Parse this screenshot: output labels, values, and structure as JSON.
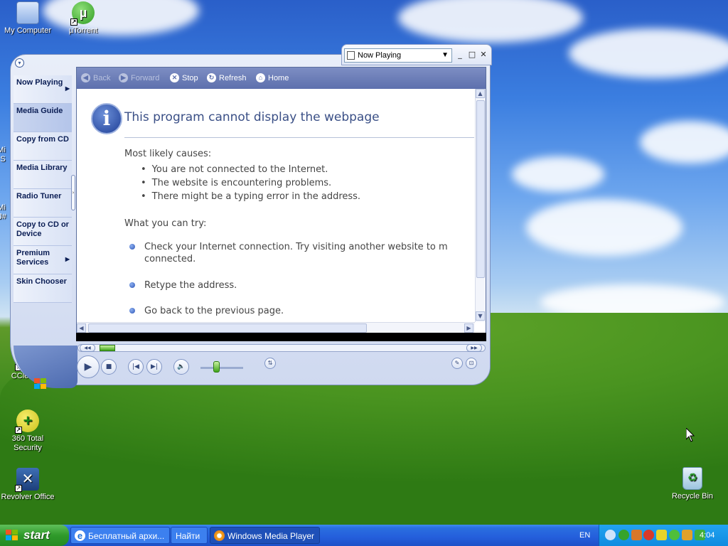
{
  "desktop": {
    "icons": [
      {
        "label": "My Computer",
        "icon": "computer-icon"
      },
      {
        "label": "µTorrent",
        "icon": "utorrent-icon"
      },
      {
        "label": "CCleaner",
        "icon": "ccleaner-icon"
      },
      {
        "label": "360 Total Security",
        "icon": "360-security-icon"
      },
      {
        "label": "Revolver Office",
        "icon": "revolver-office-icon"
      },
      {
        "label": "Recycle Bin",
        "icon": "recycle-bin-icon"
      }
    ],
    "partial_labels": [
      "Mi",
      "S",
      "Mi",
      "J#"
    ]
  },
  "wmp": {
    "now_playing_select": "Now Playing",
    "window_buttons": {
      "minimize": "_",
      "maximize": "□",
      "close": "✕"
    },
    "sidebar": [
      {
        "label": "Now Playing",
        "arrow": true,
        "active": false
      },
      {
        "label": "Media Guide",
        "arrow": false,
        "active": true
      },
      {
        "label": "Copy from CD",
        "arrow": false,
        "active": false
      },
      {
        "label": "Media Library",
        "arrow": false,
        "active": false
      },
      {
        "label": "Radio Tuner",
        "arrow": false,
        "active": false
      },
      {
        "label": "Copy to CD or Device",
        "arrow": false,
        "active": false
      },
      {
        "label": "Premium Services",
        "arrow": true,
        "active": false
      },
      {
        "label": "Skin Chooser",
        "arrow": false,
        "active": false
      }
    ],
    "nav": {
      "back": "Back",
      "forward": "Forward",
      "stop": "Stop",
      "refresh": "Refresh",
      "home": "Home"
    },
    "page": {
      "title": "This program cannot display the webpage",
      "causes_heading": "Most likely causes:",
      "causes": [
        "You are not connected to the Internet.",
        "The website is encountering problems.",
        "There might be a typing error in the address."
      ],
      "try_heading": "What you can try:",
      "try_items": [
        "Check your Internet connection. Try visiting another website to m",
        "connected.",
        "Retype the address.",
        "Go back to the previous page."
      ]
    },
    "seek_progress_percent": 4,
    "volume_percent": 30
  },
  "taskbar": {
    "start_label": "start",
    "buttons": [
      {
        "label": "Бесплатный архи...",
        "icon": "ie-icon",
        "pressed": false
      },
      {
        "label": "Найти",
        "icon": "",
        "pressed": false
      },
      {
        "label": "Windows Media Player",
        "icon": "wmp-icon",
        "pressed": true
      }
    ],
    "language": "EN",
    "clock": "4:04"
  },
  "colors": {
    "taskbar_blue": "#245edb",
    "start_green": "#2f9a2a",
    "wmp_nav": "#5d70ad",
    "error_title": "#3a4f86"
  }
}
